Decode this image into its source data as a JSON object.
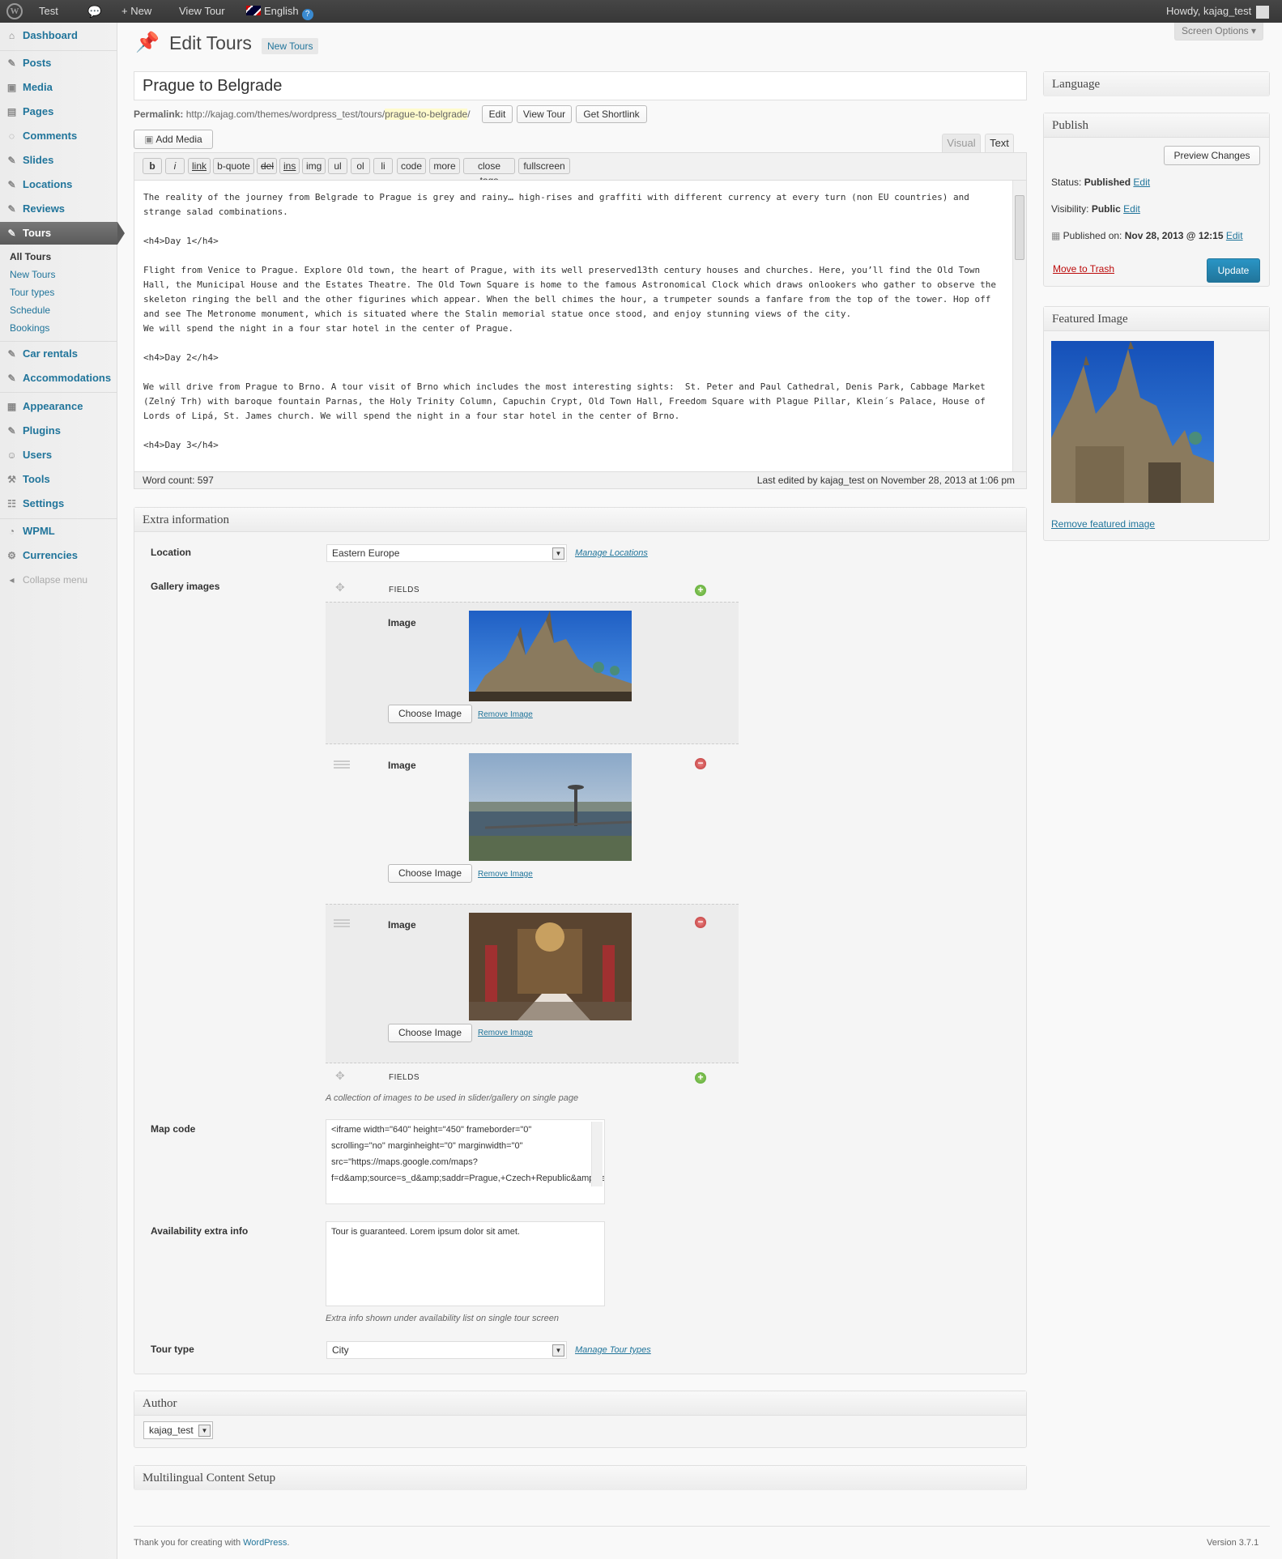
{
  "adminbar": {
    "site_name": "Test",
    "new_label": "New",
    "view_label": "View Tour",
    "language": "English",
    "howdy": "Howdy, kajag_test"
  },
  "sidebar": {
    "dashboard": "Dashboard",
    "posts": "Posts",
    "media": "Media",
    "pages": "Pages",
    "comments": "Comments",
    "slides": "Slides",
    "locations": "Locations",
    "reviews": "Reviews",
    "tours": "Tours",
    "tours_sub": [
      "All Tours",
      "New Tours",
      "Tour types",
      "Schedule",
      "Bookings"
    ],
    "car_rentals": "Car rentals",
    "accommodations": "Accommodations",
    "appearance": "Appearance",
    "plugins": "Plugins",
    "users": "Users",
    "tools": "Tools",
    "settings": "Settings",
    "wpml": "WPML",
    "currencies": "Currencies",
    "collapse": "Collapse menu"
  },
  "header": {
    "title": "Edit Tours",
    "add_new": "New Tours",
    "screen_options": "Screen Options"
  },
  "post": {
    "title": "Prague to Belgrade",
    "permalink_label": "Permalink:",
    "permalink_base": "http://kajag.com/themes/wordpress_test/tours/",
    "permalink_slug": "prague-to-belgrade",
    "permalink_tail": "/",
    "edit_btn": "Edit",
    "view_btn": "View Tour",
    "shortlink_btn": "Get Shortlink",
    "add_media": "Add Media"
  },
  "editor": {
    "tab_visual": "Visual",
    "tab_text": "Text",
    "quicktags": [
      "b",
      "i",
      "link",
      "b-quote",
      "del",
      "ins",
      "img",
      "ul",
      "ol",
      "li",
      "code",
      "more",
      "close tags",
      "fullscreen"
    ],
    "content": "The reality of the journey from Belgrade to Prague is grey and rainy… high-rises and graffiti with different currency at every turn (non EU countries) and strange salad combinations.\n\n<h4>Day 1</h4>\n\nFlight from Venice to Prague. Explore Old town, the heart of Prague, with its well preserved13th century houses and churches. Here, you’ll find the Old Town Hall, the Municipal House and the Estates Theatre. The Old Town Square is home to the famous Astronomical Clock which draws onlookers who gather to observe the skeleton ringing the bell and the other figurines which appear. When the bell chimes the hour, a trumpeter sounds a fanfare from the top of the tower. Hop off and see The Metronome monument, which is situated where the Stalin memorial statue once stood, and enjoy stunning views of the city.\nWe will spend the night in a four star hotel in the center of Prague.\n\n<h4>Day 2</h4>\n\nWe will drive from Prague to Brno. A tour visit of Brno which includes the most interesting sights:  St. Peter and Paul Cathedral, Denis Park, Cabbage Market (Zelný Trh) with baroque fountain Parnas, the Holy Trinity Column, Capuchin Crypt, Old Town Hall, Freedom Square with Plague Pillar, Klein´s Palace, House of Lords of Lipá, St. James church. We will spend the night in a four star hotel in the center of Brno.\n\n<h4>Day 3</h4>",
    "word_count": "Word count: 597",
    "last_edited": "Last edited by kajag_test on November 28, 2013 at 1:06 pm"
  },
  "extra": {
    "title": "Extra information",
    "location_label": "Location",
    "location_value": "Eastern Europe",
    "manage_locations": "Manage Locations",
    "gallery_label": "Gallery images",
    "fields_label": "FIELDS",
    "image_label": "Image",
    "choose_image": "Choose Image",
    "remove_image": "Remove Image",
    "gallery_desc": "A collection of images to be used in slider/gallery on single page",
    "map_label": "Map code",
    "map_value": "<iframe width=\"640\" height=\"450\" frameborder=\"0\" scrolling=\"no\" marginheight=\"0\" marginwidth=\"0\" src=\"https://maps.google.com/maps?f=d&amp;source=s_d&amp;saddr=Prague,+Czech+Republic&amp;daddr=Belgrade&amp;hl=en&",
    "avail_label": "Availability extra info",
    "avail_value": "Tour is guaranteed. Lorem ipsum dolor sit amet.",
    "avail_desc": "Extra info shown under availability list on single tour screen",
    "tourtype_label": "Tour type",
    "tourtype_value": "City",
    "manage_tourtypes": "Manage Tour types"
  },
  "author": {
    "title": "Author",
    "value": "kajag_test"
  },
  "multilingual": {
    "title": "Multilingual Content Setup"
  },
  "language_box": {
    "title": "Language"
  },
  "publish": {
    "title": "Publish",
    "preview": "Preview Changes",
    "status_label": "Status:",
    "status_value": "Published",
    "visibility_label": "Visibility:",
    "visibility_value": "Public",
    "published_label": "Published on:",
    "published_value": "Nov 28, 2013 @ 12:15",
    "edit": "Edit",
    "trash": "Move to Trash",
    "update": "Update"
  },
  "featured": {
    "title": "Featured Image",
    "remove": "Remove featured image"
  },
  "footer": {
    "thanks": "Thank you for creating with ",
    "wp": "WordPress",
    "dot": ".",
    "version": "Version 3.7.1"
  },
  "colors": {
    "link": "#21759b",
    "update_btn": "#2a95c5",
    "trash": "#bc0b0b",
    "adminbar": "#464646"
  }
}
